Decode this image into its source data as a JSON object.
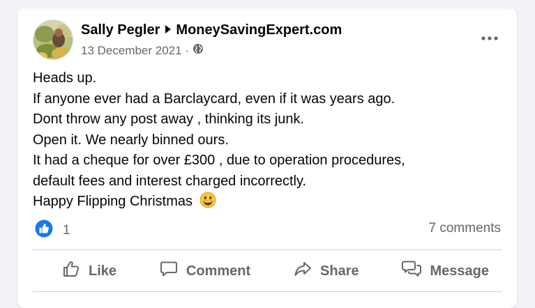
{
  "post": {
    "author": "Sally Pegler",
    "group": "MoneySavingExpert.com",
    "date": "13 December 2021",
    "separator": "·",
    "audience_icon": "globe-icon",
    "body_lines": [
      "Heads up.",
      "If anyone ever had a Barclaycard,  even if it was years ago.",
      "Dont throw any post away , thinking its junk.",
      "Open it.  We nearly binned ours.",
      "It had a cheque for over £300 , due to operation procedures,",
      "default fees and interest charged incorrectly.",
      "Happy Flipping Christmas"
    ],
    "reaction_icon": "like-reaction-icon",
    "reaction_count": "1",
    "comments_label": "7 comments"
  },
  "actions": {
    "like": "Like",
    "comment": "Comment",
    "share": "Share",
    "message": "Message"
  },
  "colors": {
    "page_bg": "#f0f2f5",
    "card_bg": "#ffffff",
    "text": "#050505",
    "secondary_text": "#65676b",
    "like_blue": "#1877f2",
    "divider": "#ced0d4"
  }
}
